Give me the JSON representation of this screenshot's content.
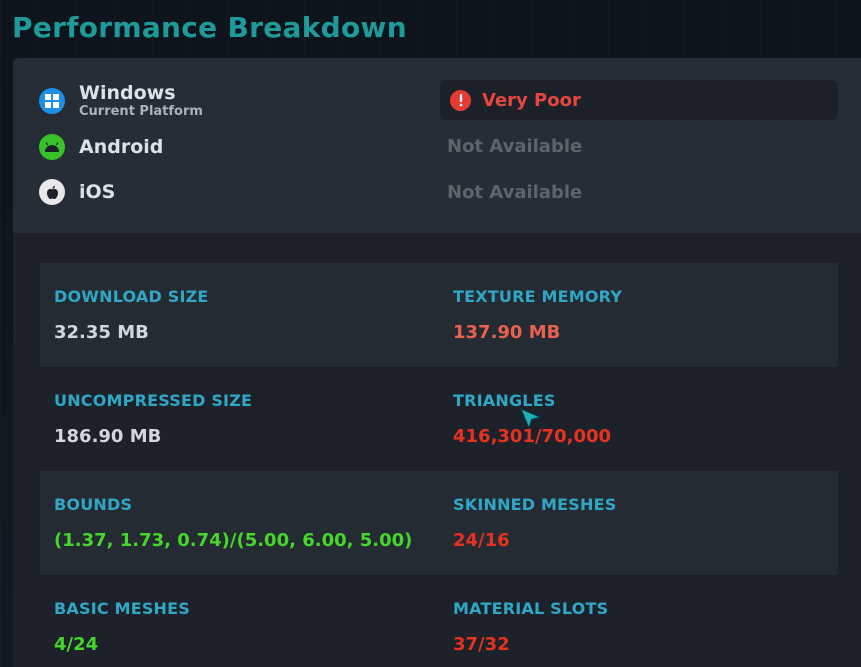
{
  "page": {
    "title": "Performance Breakdown"
  },
  "platforms": [
    {
      "name": "Windows",
      "subtitle": "Current Platform",
      "icon": "windows-icon",
      "color": "#1e90e6"
    },
    {
      "name": "Android",
      "subtitle": "",
      "icon": "android-icon",
      "color": "#38c22a"
    },
    {
      "name": "iOS",
      "subtitle": "",
      "icon": "apple-icon",
      "color": "#e8e8e8"
    }
  ],
  "ratings": {
    "windows": {
      "label": "Very Poor",
      "icon": "error-icon",
      "color": "#e53a31"
    },
    "android": {
      "label": "Not Available"
    },
    "ios": {
      "label": "Not Available"
    }
  },
  "stats": [
    {
      "label": "DOWNLOAD SIZE",
      "value": "32.35 MB",
      "status": "normal"
    },
    {
      "label": "TEXTURE MEMORY",
      "value": "137.90 MB",
      "status": "warning"
    },
    {
      "label": "UNCOMPRESSED SIZE",
      "value": "186.90 MB",
      "status": "normal"
    },
    {
      "label": "TRIANGLES",
      "value": "416,301/70,000",
      "status": "bad"
    },
    {
      "label": "BOUNDS",
      "value": "(1.37, 1.73, 0.74)/(5.00, 6.00, 5.00)",
      "status": "good"
    },
    {
      "label": "SKINNED MESHES",
      "value": "24/16",
      "status": "bad"
    },
    {
      "label": "BASIC MESHES",
      "value": "4/24",
      "status": "good"
    },
    {
      "label": "MATERIAL SLOTS",
      "value": "37/32",
      "status": "bad"
    }
  ],
  "colors": {
    "accent": "#1e9a9a",
    "label": "#2fa7c7",
    "good": "#45d72a",
    "warning": "#e9624f",
    "bad": "#e8321f",
    "normal": "#d2d7dd"
  }
}
